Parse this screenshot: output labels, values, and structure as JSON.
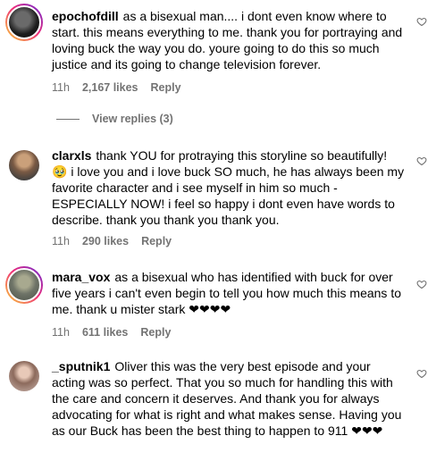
{
  "comments": [
    {
      "username": "epochofdill",
      "text": "as a bisexual man.... i dont even know where to start. this means everything to me. thank you for portraying and loving buck the way you do. youre going to do this so much justice and its going to change television forever.",
      "time": "11h",
      "likes": "2,167 likes",
      "reply": "Reply",
      "view_replies": "View replies (3)"
    },
    {
      "username": "clarxls",
      "text_before_emoji": "thank YOU for protraying this storyline so beautifully! ",
      "emoji": "🥹",
      "text_after_emoji": " i love you and i love buck SO much, he has always been my favorite character and i see myself in him so much - ESPECIALLY NOW! i feel so happy i dont even have words to describe. thank you thank you thank you.",
      "time": "11h",
      "likes": "290 likes",
      "reply": "Reply"
    },
    {
      "username": "mara_vox",
      "text": "as a bisexual who has identified with buck for over five years i can't even begin to tell you how much this means to me. thank u mister stark ❤❤❤❤",
      "time": "11h",
      "likes": "611 likes",
      "reply": "Reply"
    },
    {
      "username": "_sputnik1",
      "text": "Oliver this was the very best episode and your acting was so perfect. That you so much for handling this with the care and concern it deserves. And thank you for always advocating for what is right and what makes sense. Having you as our Buck has been the best thing to happen to 911 ❤❤❤"
    }
  ],
  "colors": {
    "meta": "#737373",
    "text": "#000000",
    "background": "#ffffff"
  }
}
